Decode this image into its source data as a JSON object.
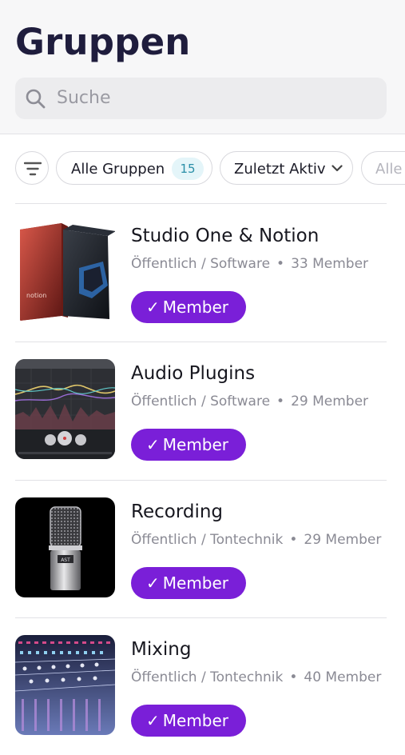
{
  "header": {
    "title": "Gruppen",
    "search_placeholder": "Suche"
  },
  "filters": {
    "all_label": "Alle Gruppen",
    "all_count": "15",
    "sort_label": "Zuletzt Aktiv",
    "more_label": "Alle"
  },
  "groups": [
    {
      "name": "Studio One & Notion",
      "category": "Öffentlich / Software",
      "members": "33 Member",
      "status": "Member",
      "icon": "software-box-image"
    },
    {
      "name": "Audio Plugins",
      "category": "Öffentlich / Software",
      "members": "29 Member",
      "status": "Member",
      "icon": "eq-plugin-image"
    },
    {
      "name": "Recording",
      "category": "Öffentlich / Tontechnik",
      "members": "29 Member",
      "status": "Member",
      "icon": "microphone-image"
    },
    {
      "name": "Mixing",
      "category": "Öffentlich / Tontechnik",
      "members": "40 Member",
      "status": "Member",
      "icon": "mixing-console-image"
    }
  ],
  "colors": {
    "accent": "#7a1fd8",
    "badge_bg": "#e4f5f9",
    "badge_text": "#2a8fa8"
  }
}
